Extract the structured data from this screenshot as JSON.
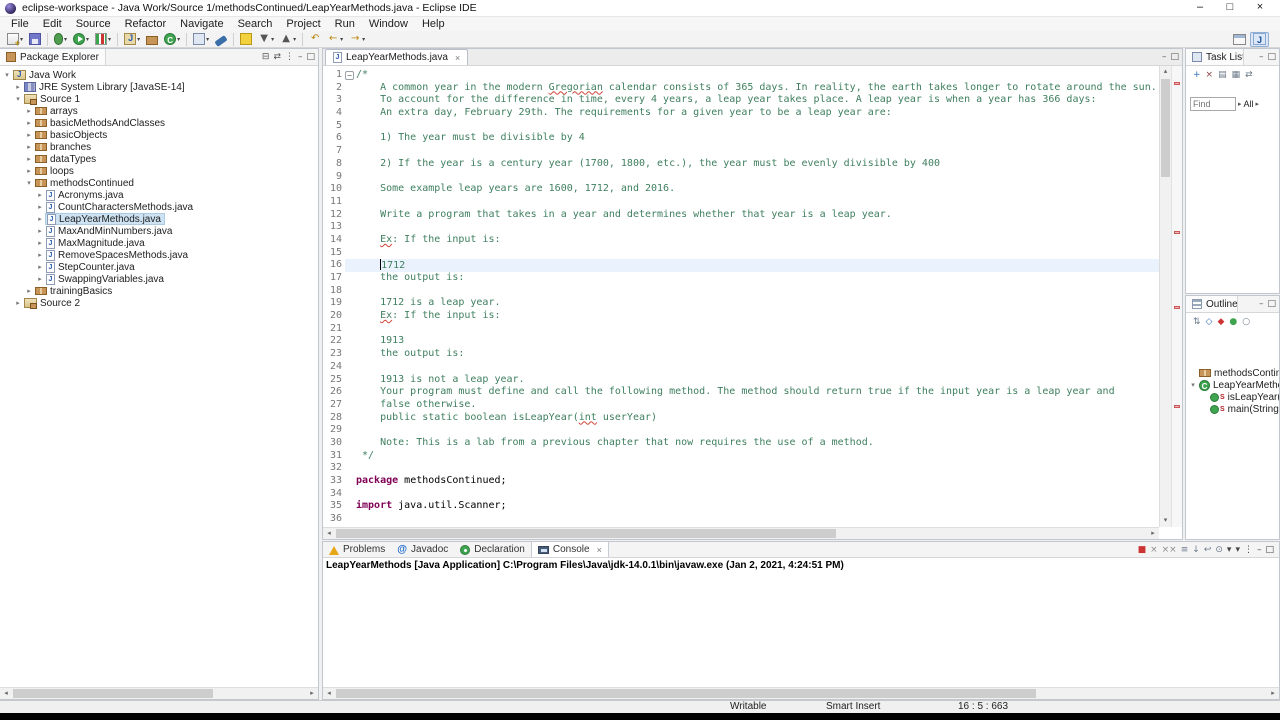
{
  "window": {
    "title": "eclipse-workspace - Java Work/Source 1/methodsContinued/LeapYearMethods.java - Eclipse IDE",
    "controls": {
      "minimize": "–",
      "maximize": "□",
      "close": "×"
    }
  },
  "menu": {
    "items": [
      "File",
      "Edit",
      "Source",
      "Refactor",
      "Navigate",
      "Search",
      "Project",
      "Run",
      "Window",
      "Help"
    ]
  },
  "toolbar": {
    "groups": [
      [
        {
          "name": "new-wizard-button",
          "css": "new",
          "dropdown": true
        },
        {
          "name": "save-button",
          "css": "save"
        }
      ],
      [
        {
          "name": "debug-button",
          "css": "debug",
          "dropdown": true
        },
        {
          "name": "run-button",
          "css": "run",
          "dropdown": true
        },
        {
          "name": "coverage-button",
          "css": "coverage",
          "dropdown": true
        }
      ],
      [
        {
          "name": "new-java-project-button",
          "css": "project",
          "dropdown": true
        },
        {
          "name": "new-package-button",
          "css": "pkg"
        },
        {
          "name": "new-class-button",
          "css": "cls",
          "dropdown": true
        }
      ],
      [
        {
          "name": "open-task-button",
          "css": "task",
          "dropdown": true
        },
        {
          "name": "search-button",
          "css": "search"
        }
      ],
      [
        {
          "name": "mark-occurrences-button",
          "css": "marker"
        },
        {
          "name": "next-annotation-button",
          "char": "▼",
          "color": "#555555",
          "dropdown": true
        },
        {
          "name": "previous-annotation-button",
          "char": "▲",
          "color": "#555555",
          "dropdown": true
        }
      ],
      [
        {
          "name": "last-edit-location-button",
          "char": "↶",
          "color": "#b8860b"
        },
        {
          "name": "back-button",
          "char": "←",
          "color": "#b8860b",
          "dropdown": true
        },
        {
          "name": "forward-button",
          "char": "→",
          "color": "#b8860b",
          "dropdown": true
        }
      ]
    ],
    "right": [
      {
        "name": "open-perspective-button",
        "css": "persp"
      },
      {
        "name": "java-perspective-button",
        "css": "javapersp",
        "active": true
      }
    ]
  },
  "package_explorer": {
    "title": "Package Explorer",
    "header_icons": [
      {
        "name": "collapse-all-icon",
        "char": "⊟",
        "color": "#555555"
      },
      {
        "name": "link-with-editor-icon",
        "char": "⇄",
        "color": "#555555"
      },
      {
        "name": "view-menu-icon",
        "char": "⋮",
        "color": "#555555"
      },
      {
        "name": "minimize-icon",
        "char": "–",
        "color": "#555555"
      },
      {
        "name": "maximize-icon",
        "char": "□",
        "color": "#555555"
      }
    ],
    "items": [
      {
        "label": "Java Work",
        "depth": 0,
        "icon": "project",
        "expand": "open"
      },
      {
        "label": "JRE System Library [JavaSE-14]",
        "depth": 1,
        "icon": "library",
        "expand": "closed"
      },
      {
        "label": "Source 1",
        "depth": 1,
        "icon": "src",
        "expand": "open"
      },
      {
        "label": "arrays",
        "depth": 2,
        "icon": "package",
        "expand": "closed"
      },
      {
        "label": "basicMethodsAndClasses",
        "depth": 2,
        "icon": "package",
        "expand": "closed"
      },
      {
        "label": "basicObjects",
        "depth": 2,
        "icon": "package",
        "expand": "closed"
      },
      {
        "label": "branches",
        "depth": 2,
        "icon": "package",
        "expand": "closed"
      },
      {
        "label": "dataTypes",
        "depth": 2,
        "icon": "package",
        "expand": "closed"
      },
      {
        "label": "loops",
        "depth": 2,
        "icon": "package",
        "expand": "closed"
      },
      {
        "label": "methodsContinued",
        "depth": 2,
        "icon": "package",
        "expand": "open"
      },
      {
        "label": "Acronyms.java",
        "depth": 3,
        "icon": "javafile",
        "expand": "closed"
      },
      {
        "label": "CountCharactersMethods.java",
        "depth": 3,
        "icon": "javafile",
        "expand": "closed"
      },
      {
        "label": "LeapYearMethods.java",
        "depth": 3,
        "icon": "javafile",
        "expand": "closed",
        "selected": true
      },
      {
        "label": "MaxAndMinNumbers.java",
        "depth": 3,
        "icon": "javafile",
        "expand": "closed"
      },
      {
        "label": "MaxMagnitude.java",
        "depth": 3,
        "icon": "javafile",
        "expand": "closed"
      },
      {
        "label": "RemoveSpacesMethods.java",
        "depth": 3,
        "icon": "javafile",
        "expand": "closed"
      },
      {
        "label": "StepCounter.java",
        "depth": 3,
        "icon": "javafile",
        "expand": "closed"
      },
      {
        "label": "SwappingVariables.java",
        "depth": 3,
        "icon": "javafile",
        "expand": "closed"
      },
      {
        "label": "trainingBasics",
        "depth": 2,
        "icon": "package",
        "expand": "closed"
      },
      {
        "label": "Source 2",
        "depth": 1,
        "icon": "src",
        "expand": "closed"
      }
    ]
  },
  "editor": {
    "tab": {
      "label": "LeapYearMethods.java",
      "close": "×"
    },
    "tabbar_icons": [
      {
        "name": "minimize-icon",
        "char": "–",
        "color": "#555555"
      },
      {
        "name": "maximize-icon",
        "char": "□",
        "color": "#555555"
      }
    ],
    "lines": [
      {
        "fold": true,
        "segs": [
          [
            "/*",
            "c"
          ]
        ]
      },
      {
        "segs": [
          [
            "    A common year in the modern ",
            "c"
          ],
          [
            "Gregorian",
            "cs"
          ],
          [
            " calendar consists of 365 days. In reality, the earth takes longer to rotate around the sun.",
            "c"
          ]
        ]
      },
      {
        "segs": [
          [
            "    To account for the difference in time, every 4 years, a leap year takes place. A leap year is when a year has 366 days:",
            "c"
          ]
        ]
      },
      {
        "segs": [
          [
            "    An extra day, February 29th. The requirements for a given year to be a leap year are:",
            "c"
          ]
        ]
      },
      {
        "segs": []
      },
      {
        "segs": [
          [
            "    1) The year must be divisible by 4",
            "c"
          ]
        ]
      },
      {
        "segs": []
      },
      {
        "segs": [
          [
            "    2) If the year is a century year (1700, 1800, etc.), the year must be evenly divisible by 400",
            "c"
          ]
        ]
      },
      {
        "segs": []
      },
      {
        "segs": [
          [
            "    Some example leap years are 1600, 1712, and 2016.",
            "c"
          ]
        ]
      },
      {
        "segs": []
      },
      {
        "segs": [
          [
            "    Write a program that takes in a year and determines whether that year is a leap year.",
            "c"
          ]
        ]
      },
      {
        "segs": []
      },
      {
        "segs": [
          [
            "    ",
            "c"
          ],
          [
            "Ex",
            "cs"
          ],
          [
            ": If the input is:",
            "c"
          ]
        ]
      },
      {
        "segs": []
      },
      {
        "current": true,
        "cursor_before_seg": 1,
        "segs": [
          [
            "    ",
            "c"
          ],
          [
            "1712",
            "c"
          ]
        ]
      },
      {
        "segs": [
          [
            "    the output is:",
            "c"
          ]
        ]
      },
      {
        "segs": []
      },
      {
        "segs": [
          [
            "    1712 is a leap year.",
            "c"
          ]
        ]
      },
      {
        "segs": [
          [
            "    ",
            "c"
          ],
          [
            "Ex",
            "cs"
          ],
          [
            ": If the input is:",
            "c"
          ]
        ]
      },
      {
        "segs": []
      },
      {
        "segs": [
          [
            "    1913",
            "c"
          ]
        ]
      },
      {
        "segs": [
          [
            "    the output is:",
            "c"
          ]
        ]
      },
      {
        "segs": []
      },
      {
        "segs": [
          [
            "    1913 is not a leap year.",
            "c"
          ]
        ]
      },
      {
        "segs": [
          [
            "    Your program must define and call the following method. The method should return true if the input year is a leap year and",
            "c"
          ]
        ]
      },
      {
        "segs": [
          [
            "    false otherwise.",
            "c"
          ]
        ]
      },
      {
        "segs": [
          [
            "    public static boolean isLeapYear(",
            "c"
          ],
          [
            "int",
            "cs"
          ],
          [
            " userYear)",
            "c"
          ]
        ]
      },
      {
        "segs": []
      },
      {
        "segs": [
          [
            "    Note: This is a lab from a previous chapter that now requires the use of a method.",
            "c"
          ]
        ]
      },
      {
        "segs": [
          [
            " */",
            "c"
          ]
        ]
      },
      {
        "segs": []
      },
      {
        "segs": [
          [
            "package",
            "k"
          ],
          [
            " methodsContinued;",
            "p"
          ]
        ]
      },
      {
        "segs": []
      },
      {
        "segs": [
          [
            "import",
            "k"
          ],
          [
            " java.util.Scanner;",
            "p"
          ]
        ]
      },
      {
        "segs": []
      }
    ]
  },
  "task_list": {
    "title": "Task List",
    "header_icons": [
      {
        "name": "minimize-icon",
        "char": "–",
        "color": "#555555"
      },
      {
        "name": "maximize-icon",
        "char": "□",
        "color": "#555555"
      }
    ],
    "toolbar_icons": [
      {
        "name": "new-task-icon",
        "char": "+",
        "color": "#2a6db5"
      },
      {
        "name": "remove-task-icon",
        "char": "×",
        "color": "#884444"
      },
      {
        "name": "categorized-icon",
        "char": "▤",
        "color": "#6a7a8a"
      },
      {
        "name": "focus-workweek-icon",
        "char": "▦",
        "color": "#6a7a8a"
      },
      {
        "name": "sync-icon",
        "char": "⇄",
        "color": "#6a7a8a"
      }
    ],
    "find_placeholder": "Find",
    "filter_label": "All"
  },
  "outline": {
    "title": "Outline",
    "header_icons": [
      {
        "name": "minimize-icon",
        "char": "–",
        "color": "#555555"
      },
      {
        "name": "maximize-icon",
        "char": "□",
        "color": "#555555"
      }
    ],
    "toolbar_icons": [
      {
        "name": "sort-icon",
        "char": "⇅",
        "color": "#6a7a8a"
      },
      {
        "name": "hide-fields-icon",
        "char": "◇",
        "color": "#2a6db5"
      },
      {
        "name": "hide-static-members-icon",
        "char": "◆",
        "color": "#cc3333"
      },
      {
        "name": "hide-non-public-icon",
        "char": "●",
        "color": "#3fa450"
      },
      {
        "name": "hide-local-types-icon",
        "char": "○",
        "color": "#6a7a8a"
      }
    ],
    "items": [
      {
        "label": "methodsContinued",
        "depth": 0,
        "icon": "package",
        "expand": "none"
      },
      {
        "label": "LeapYearMethods",
        "depth": 0,
        "icon": "class",
        "expand": "open"
      },
      {
        "label": "isLeapYear(int)",
        "depth": 1,
        "icon": "method-static",
        "expand": "none"
      },
      {
        "label": "main(String[])",
        "depth": 1,
        "icon": "method-static",
        "expand": "none"
      }
    ]
  },
  "console": {
    "tabs": [
      {
        "label": "Problems",
        "icon": "problems"
      },
      {
        "label": "Javadoc",
        "icon": "javadoc"
      },
      {
        "label": "Declaration",
        "icon": "declaration"
      },
      {
        "label": "Console",
        "icon": "console",
        "active": true,
        "close": "×"
      }
    ],
    "toolbar_icons": [
      {
        "name": "terminate-icon",
        "char": "■",
        "color": "#cc3333"
      },
      {
        "name": "remove-launch-icon",
        "char": "×",
        "color": "#8a8a8a"
      },
      {
        "name": "remove-all-launches-icon",
        "char": "××",
        "color": "#8a8a8a"
      },
      {
        "name": "clear-console-icon",
        "char": "≡",
        "color": "#6a7a8a"
      },
      {
        "name": "scroll-lock-icon",
        "char": "↓",
        "color": "#6a7a8a"
      },
      {
        "name": "word-wrap-icon",
        "char": "↩",
        "color": "#6a7a8a"
      },
      {
        "name": "pin-console-icon",
        "char": "⊙",
        "color": "#6a7a8a"
      },
      {
        "name": "display-console-icon",
        "char": "▾",
        "color": "#444444"
      },
      {
        "name": "open-console-icon",
        "char": "▾",
        "color": "#444444"
      },
      {
        "name": "view-menu-icon",
        "char": "⋮",
        "color": "#444444"
      },
      {
        "name": "minimize-icon",
        "char": "–",
        "color": "#444444"
      },
      {
        "name": "maximize-icon",
        "char": "□",
        "color": "#444444"
      }
    ],
    "header": "LeapYearMethods [Java Application] C:\\Program Files\\Java\\jdk-14.0.1\\bin\\javaw.exe (Jan 2, 2021, 4:24:51 PM)"
  },
  "status_bar": {
    "writable": "Writable",
    "insert_mode": "Smart Insert",
    "position": "16 : 5 : 663"
  }
}
